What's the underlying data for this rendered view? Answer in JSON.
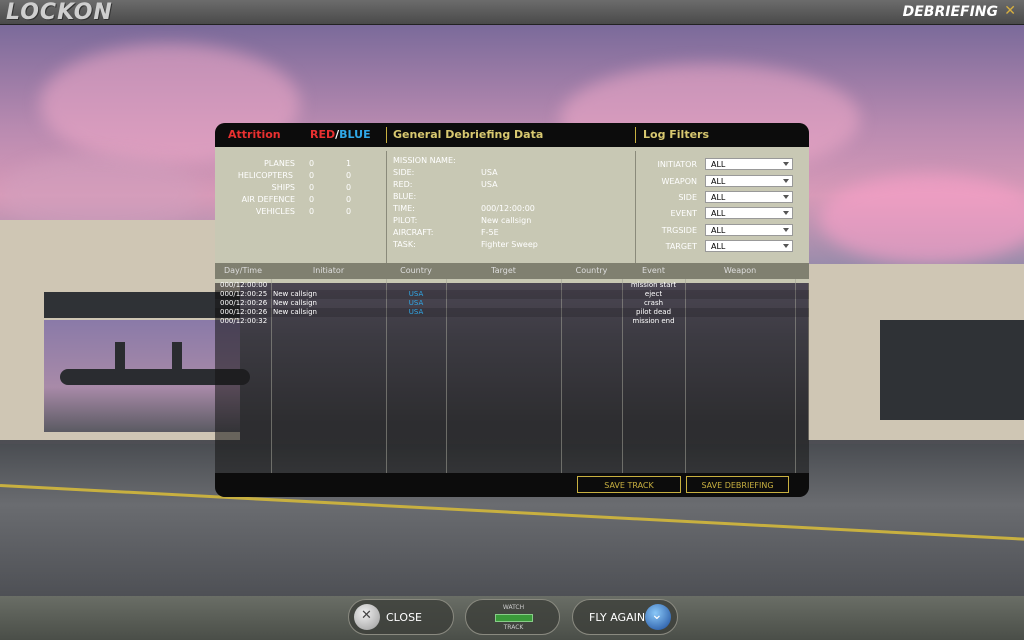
{
  "app": {
    "logo": "LOCKON",
    "screen_title": "DEBRIEFING",
    "close_glyph": "✕"
  },
  "header": {
    "attrition": "Attrition",
    "red": "RED",
    "slash": "/",
    "blue": "BLUE",
    "general": "General Debriefing Data",
    "log_filters": "Log Filters"
  },
  "attrition": [
    {
      "label": "PLANES",
      "red": "0",
      "blue": "1"
    },
    {
      "label": "HELICOPTERS",
      "red": "0",
      "blue": "0"
    },
    {
      "label": "SHIPS",
      "red": "0",
      "blue": "0"
    },
    {
      "label": "AIR DEFENCE",
      "red": "0",
      "blue": "0"
    },
    {
      "label": "VEHICLES",
      "red": "0",
      "blue": "0"
    }
  ],
  "mission": [
    {
      "label": "MISSION NAME:",
      "value": ""
    },
    {
      "label": "SIDE:",
      "value": "USA"
    },
    {
      "label": "RED:",
      "value": "USA"
    },
    {
      "label": "BLUE:",
      "value": ""
    },
    {
      "label": "TIME:",
      "value": "000/12:00:00"
    },
    {
      "label": "PILOT:",
      "value": "New callsign"
    },
    {
      "label": "AIRCRAFT:",
      "value": "F-5E"
    },
    {
      "label": "TASK:",
      "value": "Fighter Sweep"
    }
  ],
  "filters": [
    {
      "label": "INITIATOR",
      "value": "ALL"
    },
    {
      "label": "WEAPON",
      "value": "ALL"
    },
    {
      "label": "SIDE",
      "value": "ALL"
    },
    {
      "label": "EVENT",
      "value": "ALL"
    },
    {
      "label": "TRGSIDE",
      "value": "ALL"
    },
    {
      "label": "TARGET",
      "value": "ALL"
    }
  ],
  "table": {
    "columns": [
      "Day/Time",
      "Initiator",
      "Country",
      "Target",
      "Country",
      "Event",
      "Weapon"
    ],
    "rows": [
      {
        "time": "000/12:00:00",
        "initiator": "",
        "country": "",
        "target": "",
        "tcountry": "",
        "event": "mission start",
        "weapon": ""
      },
      {
        "time": "000/12:00:25",
        "initiator": "New callsign",
        "country": "USA",
        "target": "",
        "tcountry": "",
        "event": "eject",
        "weapon": ""
      },
      {
        "time": "000/12:00:26",
        "initiator": "New callsign",
        "country": "USA",
        "target": "",
        "tcountry": "",
        "event": "crash",
        "weapon": ""
      },
      {
        "time": "000/12:00:26",
        "initiator": "New callsign",
        "country": "USA",
        "target": "",
        "tcountry": "",
        "event": "pilot dead",
        "weapon": ""
      },
      {
        "time": "000/12:00:32",
        "initiator": "",
        "country": "",
        "target": "",
        "tcountry": "",
        "event": "mission end",
        "weapon": ""
      }
    ]
  },
  "footer": {
    "save_track": "SAVE TRACK",
    "save_debriefing": "SAVE DEBRIEFING"
  },
  "bottom": {
    "close": "CLOSE",
    "watch": "WATCH",
    "track": "TRACK",
    "fly_again": "FLY AGAIN"
  },
  "colors": {
    "red": "#e83030",
    "blue": "#30a8e8",
    "gold": "#c8b040",
    "info_bg": "#c8c8b4"
  }
}
